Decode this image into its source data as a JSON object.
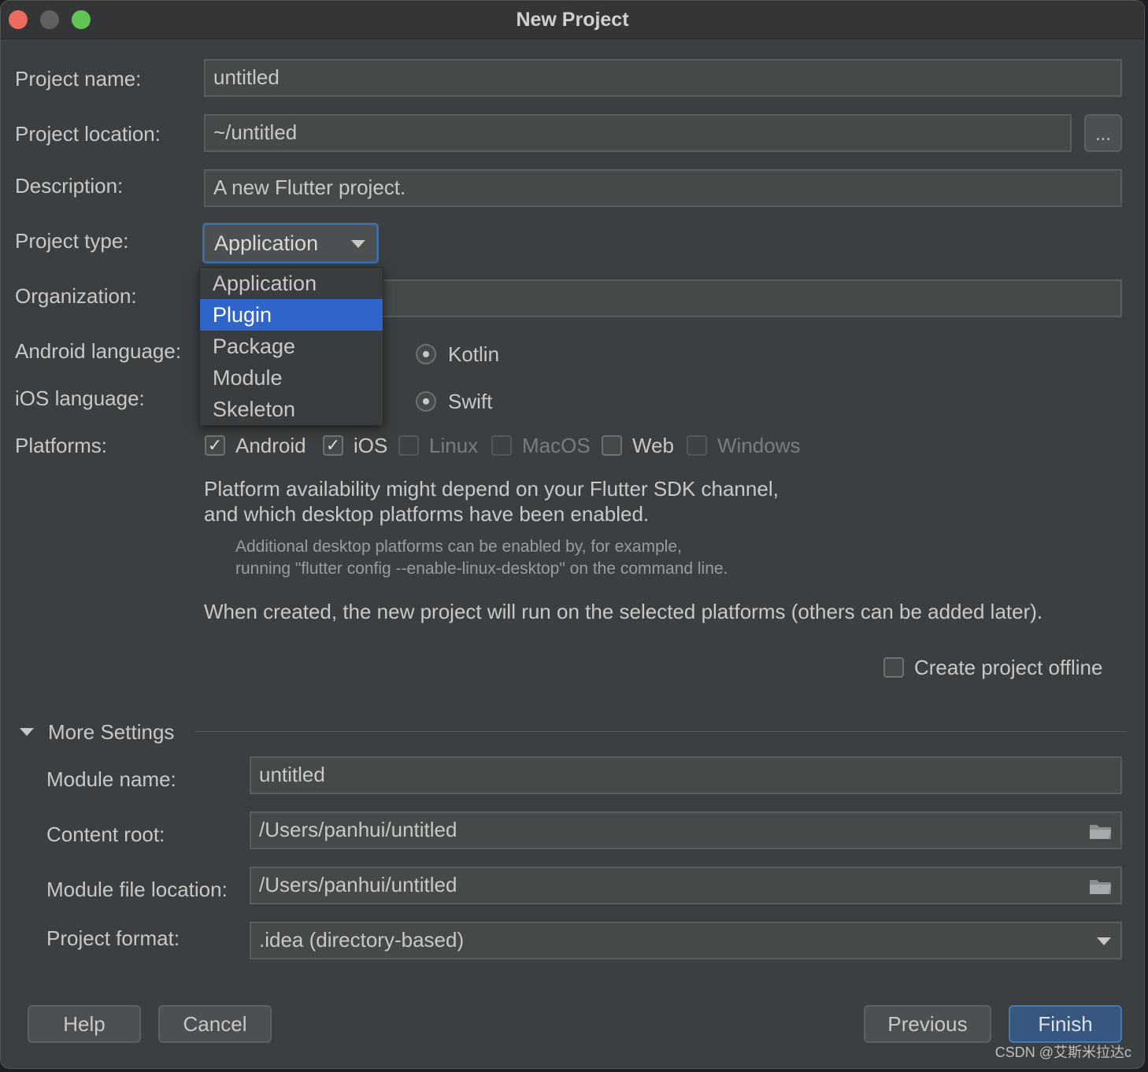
{
  "window": {
    "title": "New Project"
  },
  "form": {
    "project_name_label": "Project name:",
    "project_name_value": "untitled",
    "project_location_label": "Project location:",
    "project_location_value": "~/untitled",
    "browse_label": "...",
    "description_label": "Description:",
    "description_value": "A new Flutter project.",
    "project_type_label": "Project type:",
    "project_type_value": "Application",
    "organization_label": "Organization:",
    "android_language_label": "Android language:",
    "android_language_option": "Kotlin",
    "ios_language_label": "iOS language:",
    "ios_language_option": "Swift",
    "platforms_label": "Platforms:"
  },
  "project_type_dropdown": {
    "options": [
      "Application",
      "Plugin",
      "Package",
      "Module",
      "Skeleton"
    ],
    "selected": "Plugin"
  },
  "platforms": [
    {
      "name": "Android",
      "checked": true,
      "enabled": true
    },
    {
      "name": "iOS",
      "checked": true,
      "enabled": true
    },
    {
      "name": "Linux",
      "checked": false,
      "enabled": false
    },
    {
      "name": "MacOS",
      "checked": false,
      "enabled": false
    },
    {
      "name": "Web",
      "checked": false,
      "enabled": true
    },
    {
      "name": "Windows",
      "checked": false,
      "enabled": false
    }
  ],
  "info": {
    "line1": "Platform availability might depend on your Flutter SDK channel,",
    "line2": "and which desktop platforms have been enabled.",
    "hint1": "Additional desktop platforms can be enabled by, for example,",
    "hint2": "running \"flutter config --enable-linux-desktop\" on the command line.",
    "line3": "When created, the new project will run on the selected platforms (others can be added later)."
  },
  "offline": {
    "label": "Create project offline",
    "checked": false
  },
  "more_settings": {
    "header": "More Settings",
    "module_name_label": "Module name:",
    "module_name_value": "untitled",
    "content_root_label": "Content root:",
    "content_root_value": "/Users/panhui/untitled",
    "module_file_location_label": "Module file location:",
    "module_file_location_value": "/Users/panhui/untitled",
    "project_format_label": "Project format:",
    "project_format_value": ".idea (directory-based)"
  },
  "buttons": {
    "help": "Help",
    "cancel": "Cancel",
    "previous": "Previous",
    "finish": "Finish"
  },
  "watermark": "CSDN @艾斯米拉达c",
  "colors": {
    "accent": "#2f65ca",
    "primary_button": "#365880",
    "background": "#3c3f41"
  }
}
